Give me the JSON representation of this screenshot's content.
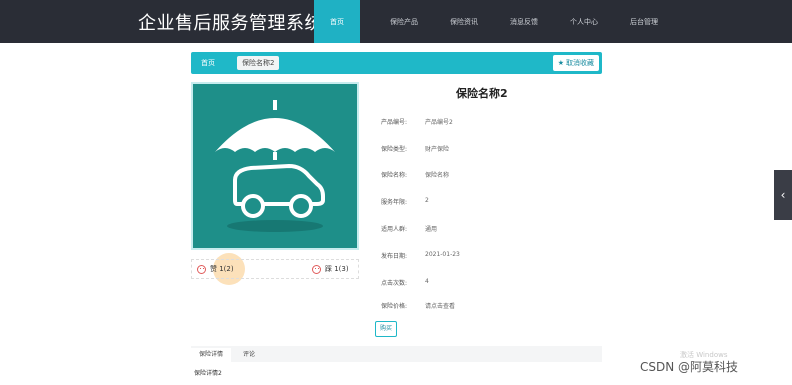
{
  "header": {
    "site_title": "企业售后服务管理系统",
    "nav": [
      "首页",
      "保险产品",
      "保险资讯",
      "消息反馈",
      "个人中心",
      "后台管理"
    ]
  },
  "breadcrumb": {
    "home": "首页",
    "current": "保险名称2"
  },
  "favorite_label": "取消收藏",
  "product": {
    "title": "保险名称2",
    "fields": [
      {
        "key": "产品编号:",
        "value": "产品编号2"
      },
      {
        "key": "保险类型:",
        "value": "财产保险"
      },
      {
        "key": "保险名称:",
        "value": "保险名称"
      },
      {
        "key": "服务年限:",
        "value": "2"
      },
      {
        "key": "适用人群:",
        "value": "通用"
      },
      {
        "key": "发布日期:",
        "value": "2021-01-23"
      },
      {
        "key": "点击次数:",
        "value": "4"
      },
      {
        "key": "保险价格:",
        "value": "请点击查看"
      }
    ],
    "up_vote": "赞 1(2)",
    "down_vote": "踩 1(3)"
  },
  "buy_label": "购买",
  "tabs": {
    "items": [
      "保险详情",
      "评论"
    ],
    "body": "保险详情2"
  },
  "watermark": "CSDN @阿莫科技",
  "windows_hint": "激活 Windows",
  "colors": {
    "accent": "#1fb8c8",
    "header": "#2a2d36",
    "image_bg": "#1e8f89"
  }
}
